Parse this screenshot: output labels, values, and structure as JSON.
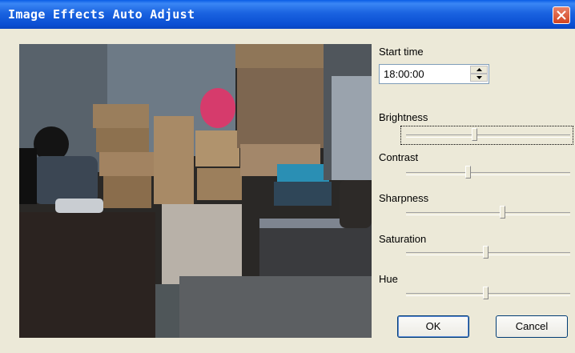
{
  "window": {
    "title": "Image Effects Auto Adjust"
  },
  "preview": {
    "description_icon": "camera-preview"
  },
  "start_time": {
    "label": "Start time",
    "value": "18:00:00"
  },
  "sliders": [
    {
      "label": "Brightness",
      "value_pct": 42
    },
    {
      "label": "Contrast",
      "value_pct": 38
    },
    {
      "label": "Sharpness",
      "value_pct": 59
    },
    {
      "label": "Saturation",
      "value_pct": 49
    },
    {
      "label": "Hue",
      "value_pct": 49
    }
  ],
  "buttons": {
    "ok": "OK",
    "cancel": "Cancel"
  },
  "colors": {
    "titlebar": "#0b4fd3",
    "dialog_bg": "#ece9d8",
    "close": "#d2431f"
  }
}
